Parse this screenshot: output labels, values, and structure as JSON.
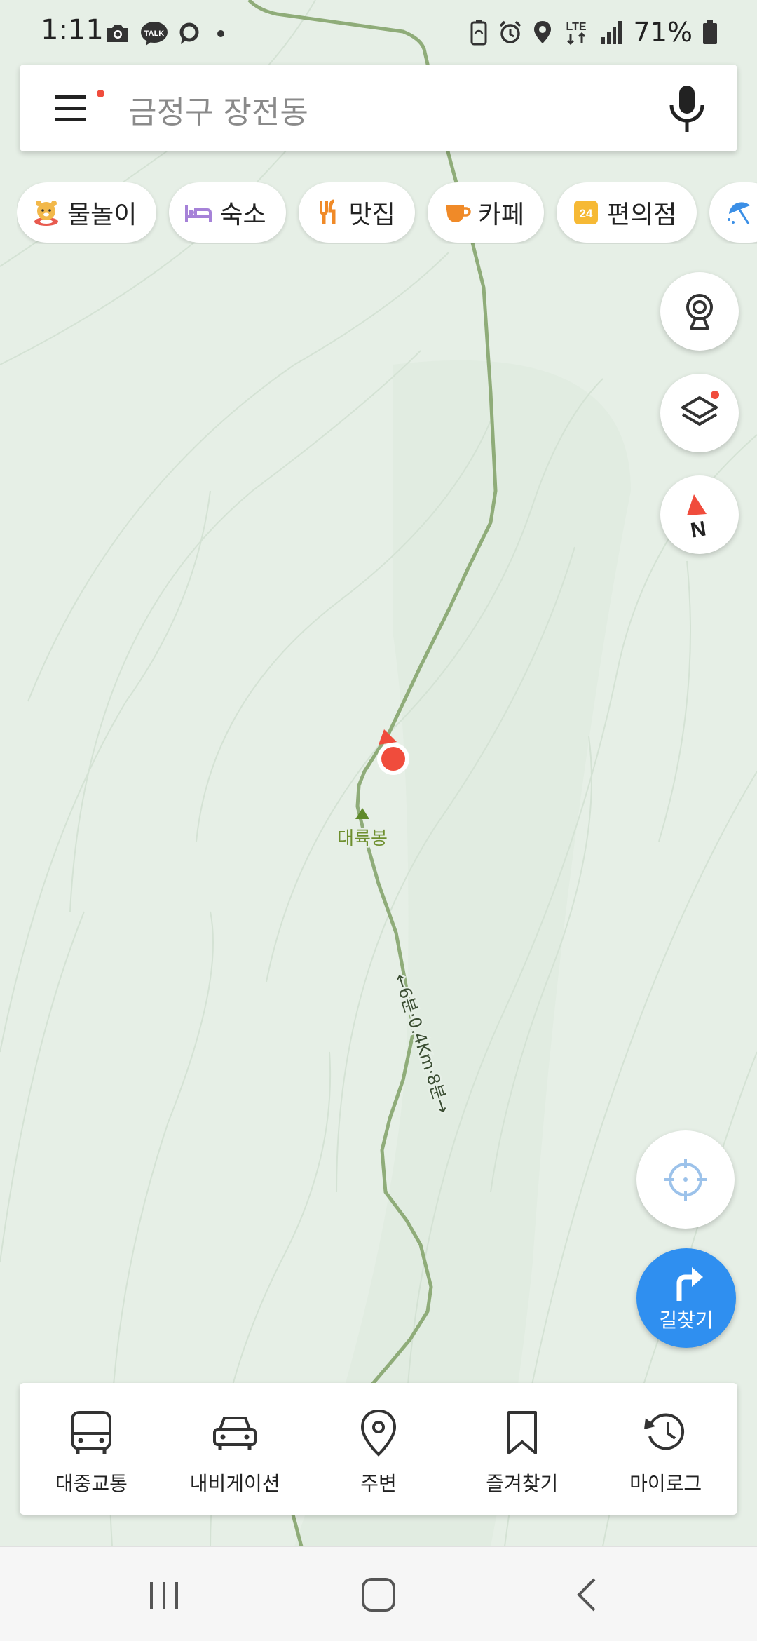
{
  "status_bar": {
    "time": "1:11",
    "battery_percent": "71%",
    "network": "LTE",
    "left_icons": [
      "camera-icon",
      "kakaotalk-icon",
      "chat-bubble-icon",
      "dot-icon"
    ],
    "right_icons": [
      "battery-saver-icon",
      "alarm-icon",
      "location-icon",
      "lte-icon",
      "signal-icon",
      "battery-icon"
    ]
  },
  "search": {
    "placeholder": "금정구 장전동",
    "menu_icon": "hamburger-menu-icon",
    "voice_icon": "microphone-icon"
  },
  "categories": [
    {
      "label": "물놀이",
      "icon": "water-play-icon"
    },
    {
      "label": "숙소",
      "icon": "bed-icon"
    },
    {
      "label": "맛집",
      "icon": "restaurant-icon"
    },
    {
      "label": "카페",
      "icon": "coffee-cup-icon"
    },
    {
      "label": "편의점",
      "icon": "convenience-store-24-icon"
    },
    {
      "label": "",
      "icon": "umbrella-icon"
    }
  ],
  "map": {
    "peak_label": "대륙봉",
    "trail_label": "←6분·0.4Km·8분→",
    "colors": {
      "map_background": "#e6efe6",
      "trail": "#8fac79",
      "current_location": "#f04c3c",
      "peak": "#5f8a2a"
    }
  },
  "map_controls": {
    "cctv_icon": "cctv-icon",
    "layers_icon": "layers-icon",
    "compass_icon": "compass-north-icon",
    "compass_label": "N",
    "locate_icon": "my-location-crosshair-icon"
  },
  "directions_button": {
    "label": "길찾기",
    "icon": "turn-right-arrow-icon",
    "color": "#2f8ff0"
  },
  "bottom_nav": [
    {
      "label": "대중교통",
      "icon": "bus-icon"
    },
    {
      "label": "내비게이션",
      "icon": "car-icon"
    },
    {
      "label": "주변",
      "icon": "map-pin-icon"
    },
    {
      "label": "즐겨찾기",
      "icon": "bookmark-icon"
    },
    {
      "label": "마이로그",
      "icon": "history-icon"
    }
  ],
  "system_nav": {
    "recents_icon": "recents-icon",
    "home_icon": "home-icon",
    "back_icon": "back-icon"
  }
}
